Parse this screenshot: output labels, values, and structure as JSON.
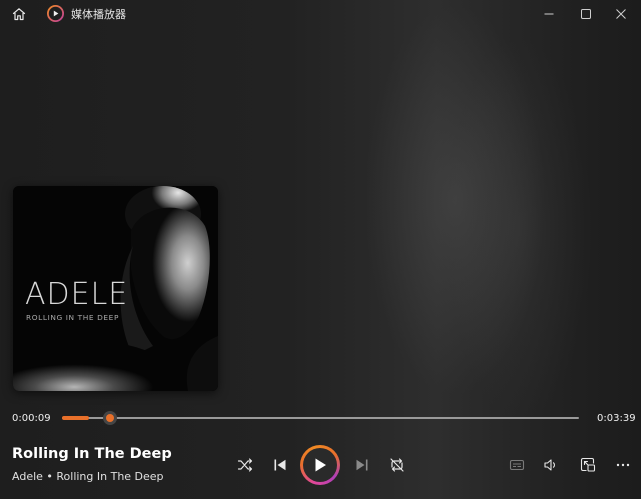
{
  "window": {
    "title": "媒体播放器"
  },
  "album_art": {
    "artist_text": "ADELE",
    "subtitle_text": "ROLLING IN THE DEEP"
  },
  "playback": {
    "current_time": "0:00:09",
    "total_time": "0:03:39",
    "progress_fraction": 0.041
  },
  "now_playing": {
    "title": "Rolling In The Deep",
    "subtitle": "Adele • Rolling In The Deep"
  },
  "colors": {
    "accent": "#e8702a",
    "background": "#1c1c1c"
  },
  "icons": {
    "home": "home-icon",
    "app": "media-player-icon",
    "shuffle": "shuffle-icon",
    "previous": "previous-icon",
    "play": "play-icon",
    "next": "next-icon",
    "repeat": "repeat-off-icon",
    "captions": "captions-icon",
    "volume": "volume-icon",
    "miniplayer": "miniplayer-icon",
    "more": "more-icon"
  }
}
